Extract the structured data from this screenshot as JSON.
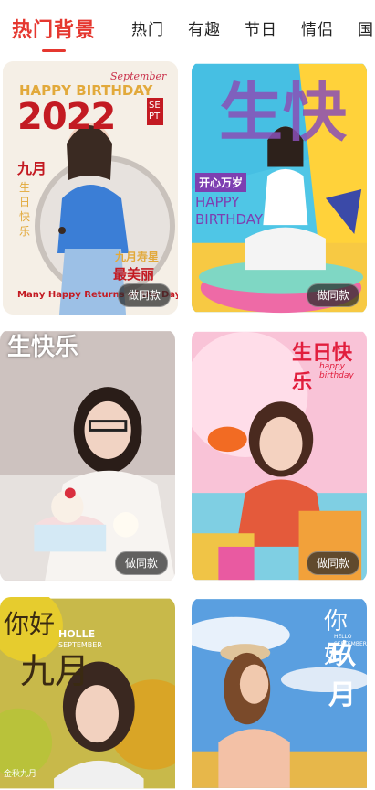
{
  "tabs": [
    "热门背景",
    "热门",
    "有趣",
    "节日",
    "情侣",
    "国"
  ],
  "cards": [
    {
      "big_text": "2022",
      "sub": "HAPPY BIRTHDAY",
      "side": "九月",
      "side2": "生日快乐",
      "corner": "SEPT",
      "script": "September",
      "line1": "九月寿星",
      "line2": "最美丽",
      "footer": "Many Happy Returns of the Day",
      "button": "做同款"
    },
    {
      "big_text": "生快",
      "badge": "开心万岁",
      "eng": "HAPPY BIRTHDAY",
      "button": "做同款"
    },
    {
      "big_text": "生快乐",
      "button": "做同款"
    },
    {
      "big_text": "生日快乐",
      "script": "happy birthday",
      "button": "做同款"
    },
    {
      "big_text": "你好",
      "big_text2": "九月",
      "eng1": "HOLLE",
      "eng2": "SEPTEMBER",
      "footer": "金秋九月"
    },
    {
      "big_text": "你好",
      "big_text2": "玖月",
      "eng1": "HELLO",
      "eng2": "SEPTEMBER"
    }
  ]
}
